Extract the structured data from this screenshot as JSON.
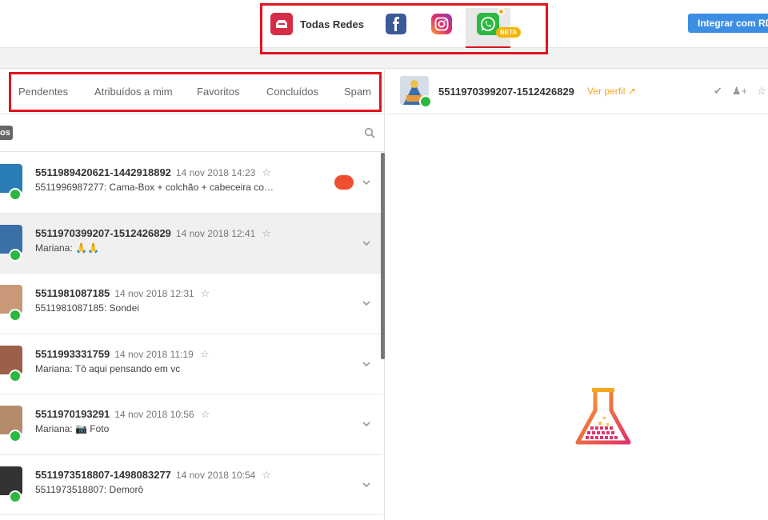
{
  "networks": {
    "all_label": "Todas Redes",
    "beta_label": "BETA"
  },
  "integrate_button": "Integrar com RD",
  "tabs": [
    "Pendentes",
    "Atribuídos a mim",
    "Favoritos",
    "Concluídos",
    "Spam"
  ],
  "filter_chip": "os",
  "conversations": [
    {
      "name": "5511989420621-1442918892",
      "time": "14 nov 2018 14:23",
      "message": "5511996987277: Cama-Box + colchão + cabeceira co…",
      "unread": true,
      "selected": false,
      "avatar_color": "#2a7db5"
    },
    {
      "name": "5511970399207-1512426829",
      "time": "14 nov 2018 12:41",
      "message": "Mariana: 🙏🙏",
      "unread": false,
      "selected": true,
      "avatar_color": "#3a6fa8"
    },
    {
      "name": "5511981087185",
      "time": "14 nov 2018 12:31",
      "message": "5511981087185: Sondei",
      "unread": false,
      "selected": false,
      "avatar_color": "#c89878"
    },
    {
      "name": "5511993331759",
      "time": "14 nov 2018 11:19",
      "message": "Mariana: Tô aqui pensando em vc",
      "unread": false,
      "selected": false,
      "avatar_color": "#9a6048"
    },
    {
      "name": "5511970193291",
      "time": "14 nov 2018 10:56",
      "message": "Mariana: 📷 Foto",
      "unread": false,
      "selected": false,
      "avatar_color": "#b48c6c"
    },
    {
      "name": "5511973518807-1498083277",
      "time": "14 nov 2018 10:54",
      "message": "5511973518807: Demorô",
      "unread": false,
      "selected": false,
      "avatar_color": "#333333"
    }
  ],
  "conversation_header": {
    "name": "5511970399207-1512426829",
    "profile_link": "Ver perfil"
  },
  "colors": {
    "highlight": "#e0141e",
    "whatsapp": "#2bb741",
    "accent": "#f5a623",
    "primary": "#3c8ee3"
  }
}
